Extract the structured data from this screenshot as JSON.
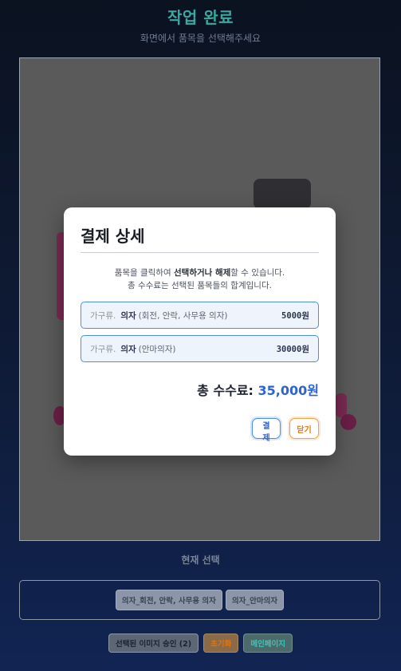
{
  "header": {
    "title": "작업 완료",
    "subtitle": "화면에서 품목을 선택해주세요"
  },
  "modal": {
    "title": "결제 상세",
    "desc_line1_prefix": "품목을 클릭하여 ",
    "desc_line1_bold": "선택하거나 해제",
    "desc_line1_suffix": "할 수 있습니다.",
    "desc_line2": "총 수수료는 선택된 품목들의 합계입니다.",
    "items": [
      {
        "category": "가구류.",
        "name": "의자",
        "detail": "(회전, 안락, 사무용 의자)",
        "price": "5000원"
      },
      {
        "category": "가구류.",
        "name": "의자",
        "detail": "(안마의자)",
        "price": "30000원"
      }
    ],
    "total_label": "총 수수료:",
    "total_amount": "35,000원",
    "pay_label": "결제",
    "close_label": "닫기"
  },
  "selection": {
    "label": "현재 선택",
    "chips": [
      "의자_회전, 안락, 사무용 의자",
      "의자_안마의자"
    ]
  },
  "footer": {
    "approve_label": "선택된 이미지 승인 (2)",
    "reset_label": "초기화",
    "main_label": "메인페이지"
  },
  "colors": {
    "accent_teal": "#3aa8a0",
    "accent_blue": "#2c63d6",
    "accent_orange": "#e57a12"
  }
}
